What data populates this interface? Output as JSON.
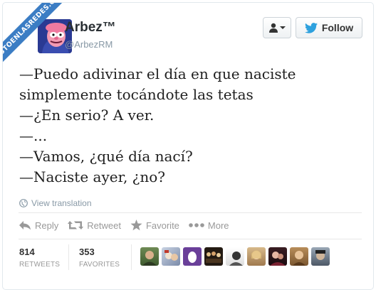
{
  "watermark": "VISTOENLASREDES.COM",
  "user": {
    "name": "Arbez™",
    "handle": "@ArbezRM"
  },
  "buttons": {
    "follow_label": "Follow"
  },
  "tweet": {
    "lines": [
      "—Puedo adivinar el día en que naciste",
      "simplemente tocándote las tetas",
      "—¿En serio? A ver.",
      "—...",
      "—Vamos, ¿qué día nací?",
      "—Naciste ayer, ¿no?"
    ]
  },
  "translation_label": "View translation",
  "actions": {
    "reply": "Reply",
    "retweet": "Retweet",
    "favorite": "Favorite",
    "more": "More"
  },
  "stats": {
    "retweets": {
      "count": "814",
      "label": "RETWEETS"
    },
    "favorites": {
      "count": "353",
      "label": "FAVORITES"
    }
  },
  "colors": {
    "twitter_blue": "#2ea1de",
    "ribbon": "#3b7dc4",
    "muted": "#999999"
  }
}
